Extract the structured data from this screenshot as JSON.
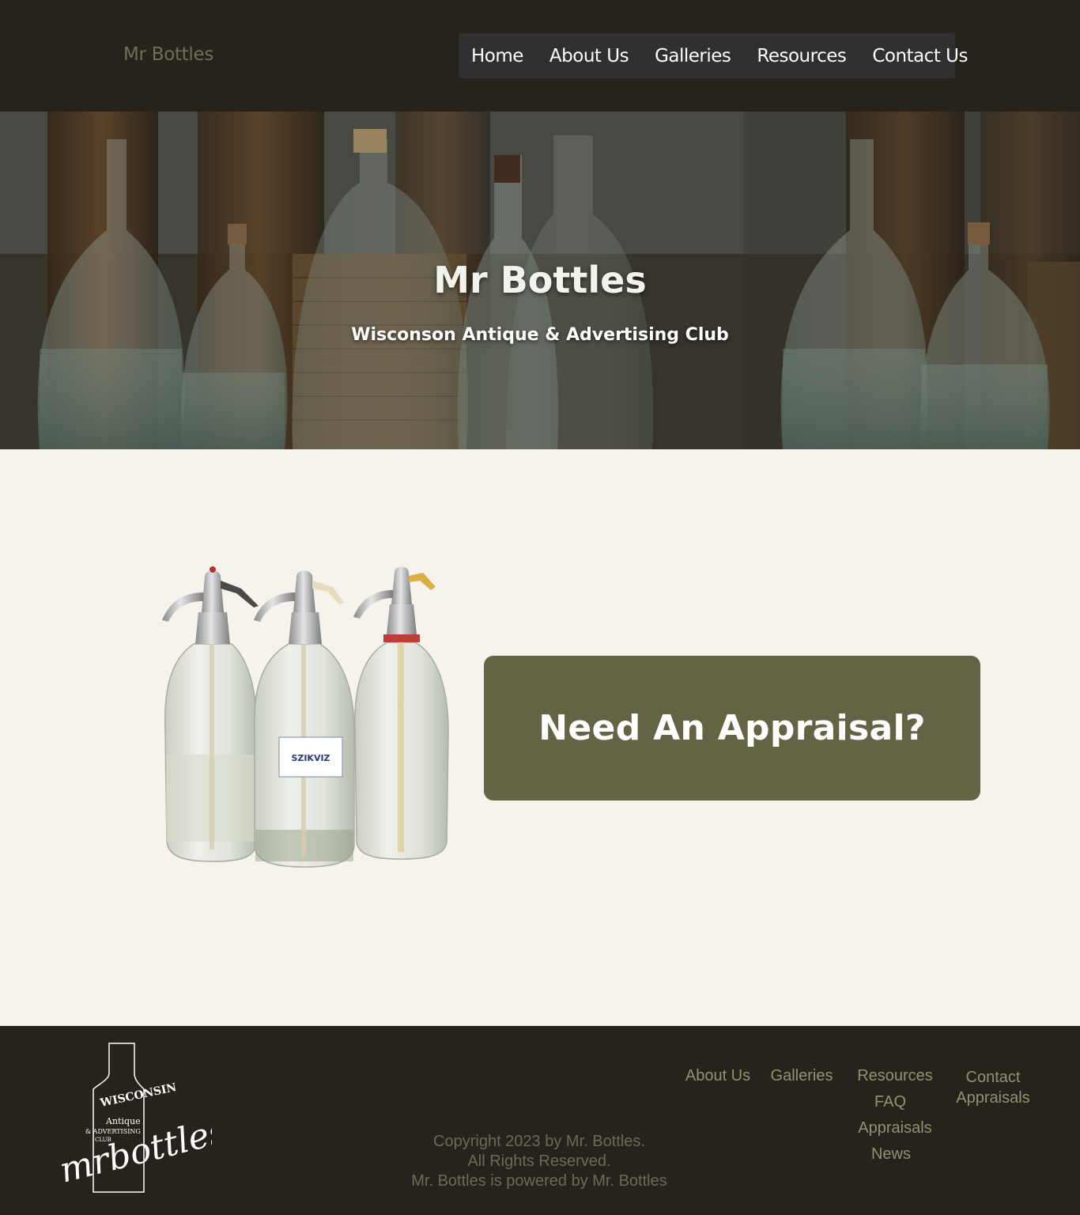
{
  "header": {
    "site_name": "Mr Bottles",
    "nav": [
      "Home",
      "About Us",
      "Galleries",
      "Resources",
      "Contact Us"
    ]
  },
  "hero": {
    "title": "Mr Bottles",
    "subtitle": "Wisconson Antique & Advertising Club"
  },
  "main": {
    "cta_label": "Need An Appraisal?",
    "image_label": "SZIKVIZ"
  },
  "footer": {
    "logo_text": {
      "top": "WISCONSIN",
      "middle": "Antique",
      "lower": "& ADVERTISING",
      "club": "CLUB",
      "script": "mrbottles"
    },
    "copyright": {
      "line1": "Copyright 2023 by Mr. Bottles.",
      "line2": "All Rights Reserved.",
      "line3": "Mr. Bottles is powered by Mr. Bottles"
    },
    "links": {
      "about": "About Us",
      "galleries": "Galleries",
      "resources": "Resources",
      "faq": "FAQ",
      "appraisals": "Appraisals",
      "news": "News",
      "contact": "Contact",
      "contact_appraisals": "Appraisals"
    }
  },
  "colors": {
    "header_bg": "#26231d",
    "nav_bg": "#303030",
    "page_bg": "#f5f3ec",
    "cta_bg": "#646445",
    "footer_link": "#939170",
    "footer_text": "#6c6a55"
  }
}
